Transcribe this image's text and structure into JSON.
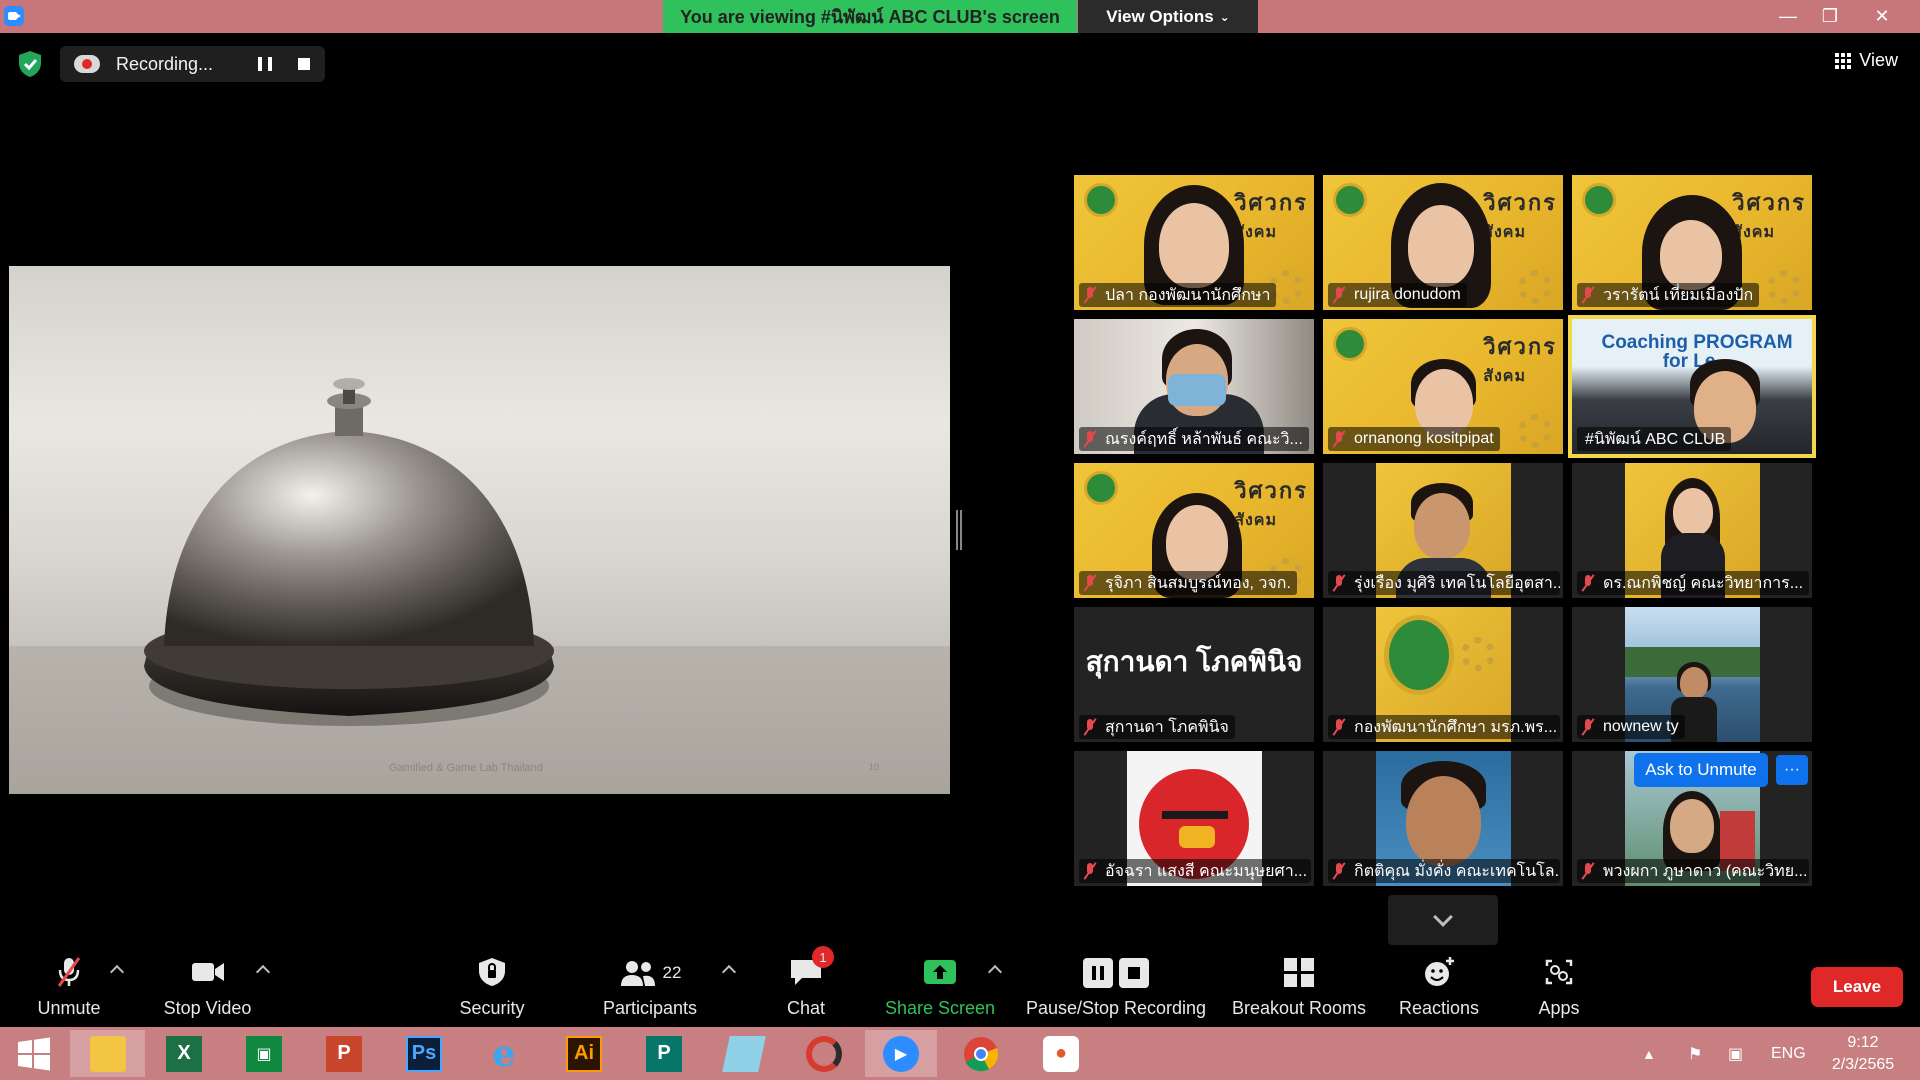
{
  "window": {
    "viewing_banner": "You are viewing #นิพัฒน์ ABC CLUB's screen",
    "view_options": "View Options"
  },
  "recording": {
    "status": "Recording..."
  },
  "top_right": {
    "view_label": "View"
  },
  "shared_screen": {
    "caption": "Gamified & Game Lab Thailand",
    "page_number": "10"
  },
  "gallery": {
    "tiles": [
      {
        "name": "ปลา กองพัฒนานักศึกษา",
        "muted": true
      },
      {
        "name": "rujira donudom",
        "muted": true
      },
      {
        "name": "วรารัตน์ เที่ยมเมืองปัก",
        "muted": true
      },
      {
        "name": "ณรงค์ฤทธิ์ หล้าพันธ์ คณะวิ...",
        "muted": true
      },
      {
        "name": "ornanong kositpipat",
        "muted": true
      },
      {
        "name": "#นิพัฒน์ ABC CLUB",
        "muted": false,
        "banner": "Coaching PROGRAM for Le..."
      },
      {
        "name": "รุจิภา สินสมบูรณ์ทอง, วจก.",
        "muted": true
      },
      {
        "name": "รุ่งเรือง มุศิริ เทคโนโลยีอุตสา...",
        "muted": true
      },
      {
        "name": "ดร.ณกพิชญ์ คณะวิทยาการ...",
        "muted": true
      },
      {
        "name": "สุกานดา โภคพินิจ",
        "muted": true,
        "display_text": "สุกานดา โภคพินิจ"
      },
      {
        "name": "กองพัฒนานักศึกษา มรภ.พร...",
        "muted": true
      },
      {
        "name": "nownew ty",
        "muted": true
      },
      {
        "name": "อัจฉรา แสงสี คณะมนุษยศา...",
        "muted": true
      },
      {
        "name": "กิตติคุณ มั่งคั่ง คณะเทคโนโล...",
        "muted": true
      },
      {
        "name": "พวงผกา ภูษาดาว (คณะวิทย...",
        "muted": true
      }
    ],
    "brand_text_top": "วิศวกร",
    "brand_text_bottom": "สังคม",
    "ask_to_unmute": "Ask to Unmute",
    "more": "···"
  },
  "toolbar": {
    "unmute": "Unmute",
    "stop_video": "Stop Video",
    "security": "Security",
    "participants": "Participants",
    "participants_count": "22",
    "chat": "Chat",
    "chat_badge": "1",
    "share_screen": "Share Screen",
    "pause_stop_recording": "Pause/Stop Recording",
    "breakout_rooms": "Breakout Rooms",
    "reactions": "Reactions",
    "apps": "Apps",
    "leave": "Leave"
  },
  "taskbar": {
    "apps": [
      "windows-start",
      "file-explorer",
      "excel",
      "store",
      "powerpoint",
      "photoshop",
      "internet-explorer",
      "illustrator",
      "publisher",
      "notepad",
      "photoscape",
      "zoom",
      "chrome",
      "paint"
    ],
    "language": "ENG",
    "time": "9:12",
    "date": "2/3/2565"
  },
  "colors": {
    "accent_green": "#2fc15b",
    "leave_red": "#e02828",
    "active_tile": "#f3d64a",
    "ask_blue": "#0e72ed"
  }
}
